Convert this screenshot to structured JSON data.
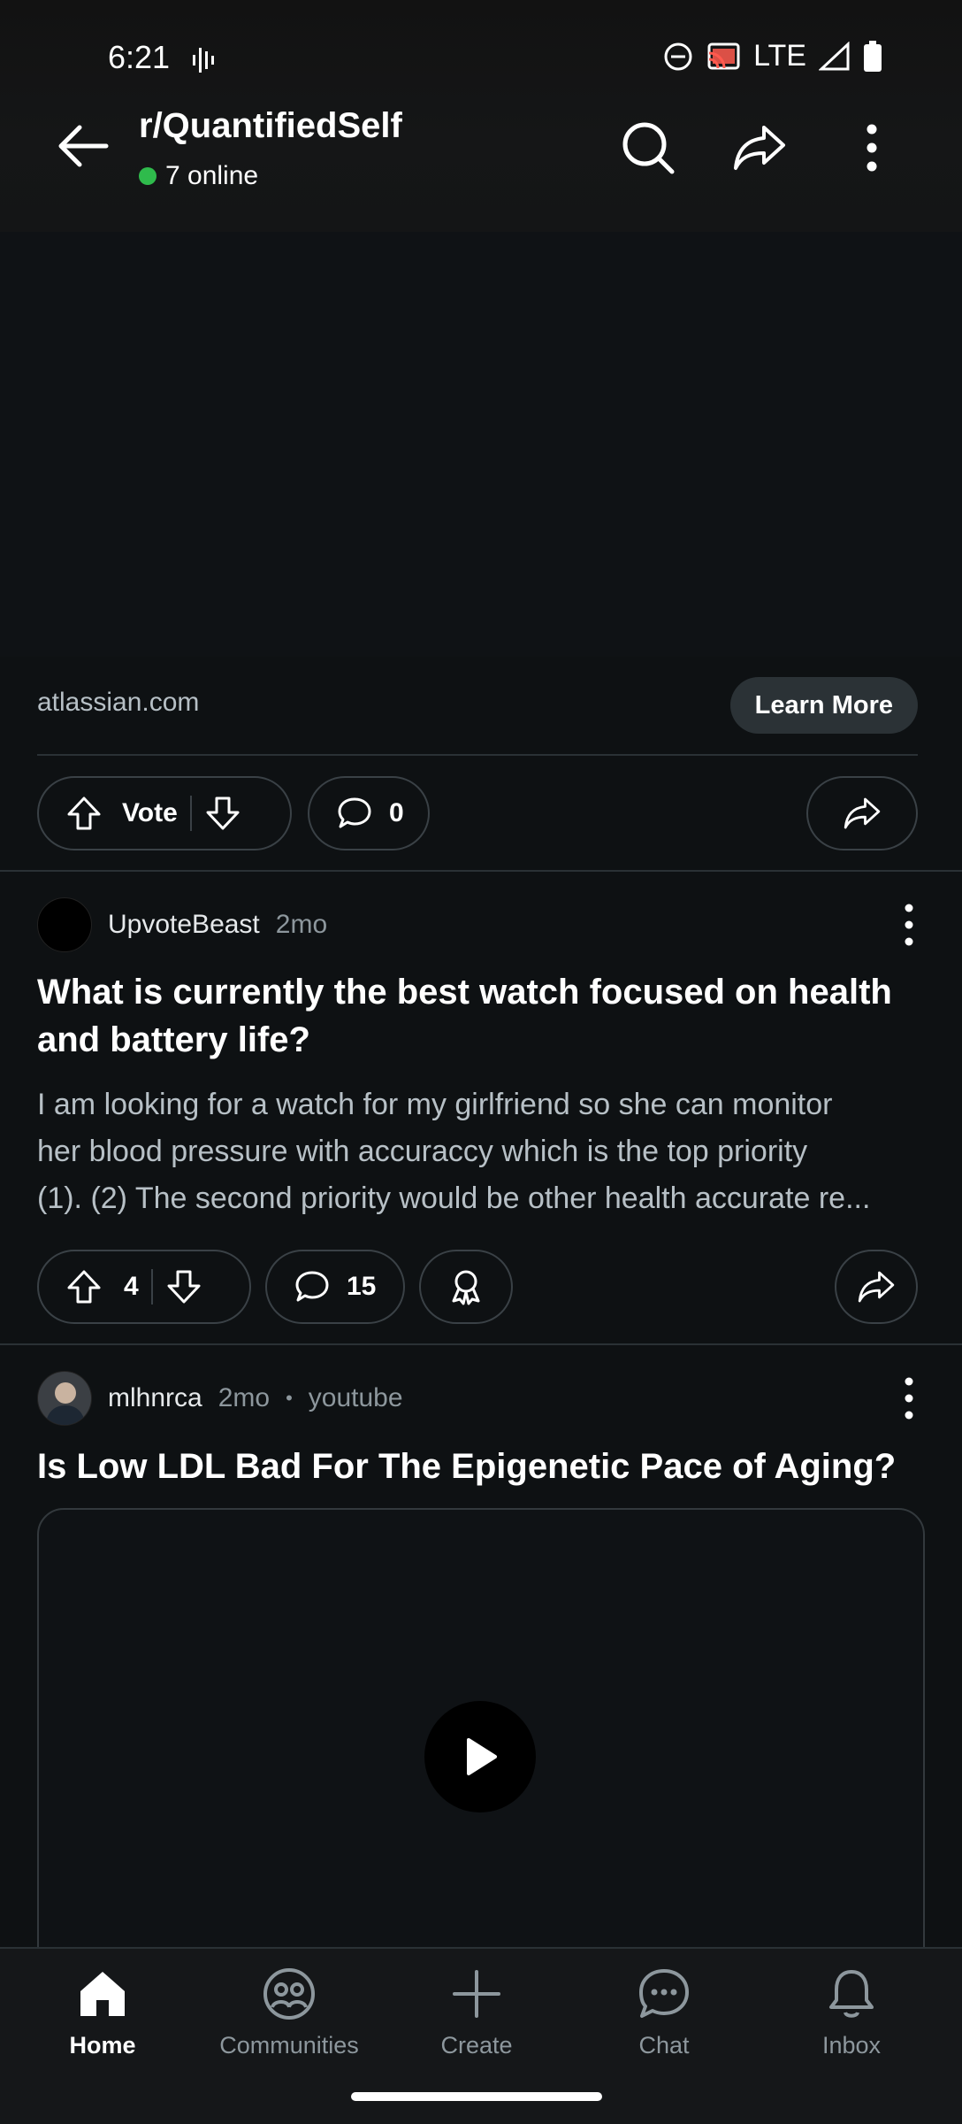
{
  "status_bar": {
    "time": "6:21",
    "network": "LTE"
  },
  "header": {
    "title": "r/QuantifiedSelf",
    "online_text": "7 online"
  },
  "ad": {
    "domain": "atlassian.com",
    "cta_label": "Learn More",
    "vote_label": "Vote",
    "comment_count": "0"
  },
  "posts": [
    {
      "author": "UpvoteBeast",
      "age": "2mo",
      "title": "What is currently the best watch focused on health and battery life?",
      "body_lines": [
        "I am looking for a watch for my girlfriend so she can monitor",
        "her blood pressure with accuraccy which is the top priority",
        "(1). (2) The second priority would be other health accurate re..."
      ],
      "score": "4",
      "comment_count": "15"
    },
    {
      "author": "mlhnrca",
      "age": "2mo",
      "source": "youtube",
      "source_sep": "•",
      "title": "Is Low LDL Bad For The Epigenetic Pace of Aging?"
    }
  ],
  "nav": {
    "items": [
      {
        "label": "Home",
        "icon": "home-icon",
        "active": true
      },
      {
        "label": "Communities",
        "icon": "communities-icon"
      },
      {
        "label": "Create",
        "icon": "plus-icon"
      },
      {
        "label": "Chat",
        "icon": "chat-icon"
      },
      {
        "label": "Inbox",
        "icon": "bell-icon"
      }
    ]
  },
  "colors": {
    "background": "#0e1113",
    "online_dot": "#2fbb4c",
    "muted_text": "#8d979d"
  }
}
